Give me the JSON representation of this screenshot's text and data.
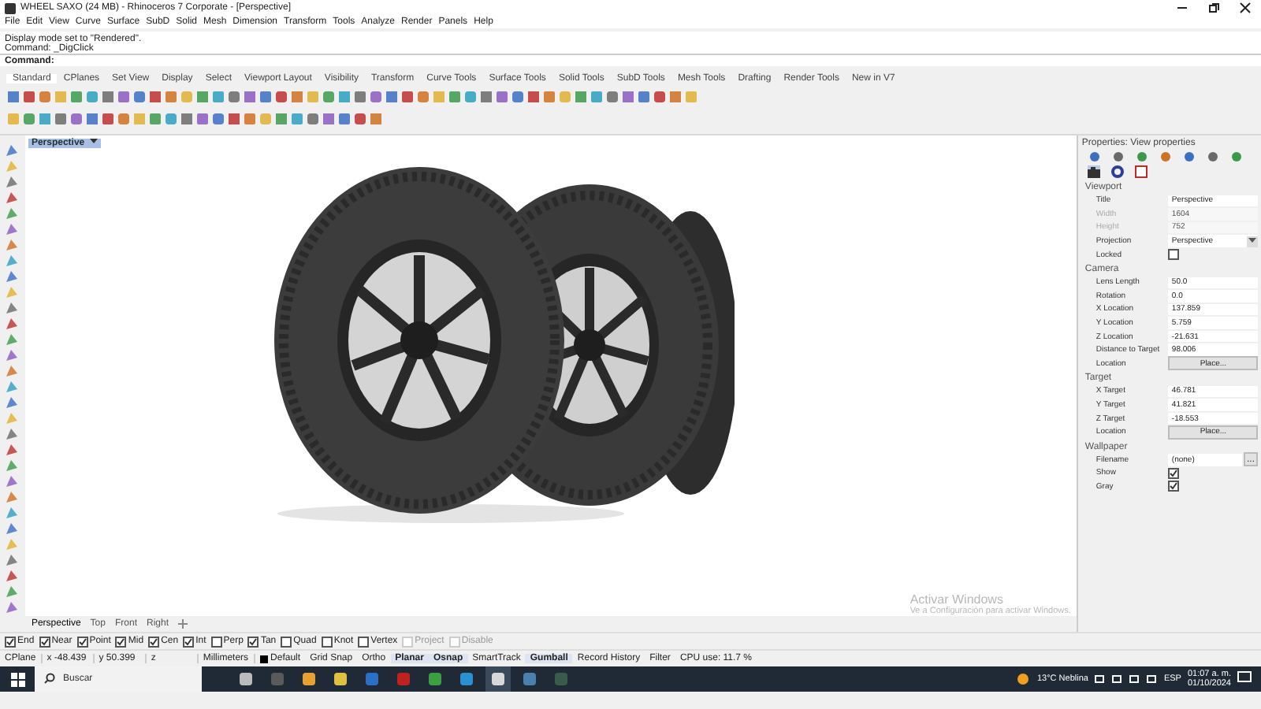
{
  "window": {
    "title": "WHEEL SAXO (24 MB) - Rhinoceros 7 Corporate - [Perspective]"
  },
  "menu": [
    "File",
    "Edit",
    "View",
    "Curve",
    "Surface",
    "SubD",
    "Solid",
    "Mesh",
    "Dimension",
    "Transform",
    "Tools",
    "Analyze",
    "Render",
    "Panels",
    "Help"
  ],
  "command_history": [
    "Display mode set to \"Rendered\".",
    "Command: _DigClick"
  ],
  "command_prompt": "Command:",
  "toolbar_tabs": [
    {
      "label": "Standard",
      "selected": true
    },
    {
      "label": "CPlanes",
      "selected": false
    },
    {
      "label": "Set View",
      "selected": false
    },
    {
      "label": "Display",
      "selected": false
    },
    {
      "label": "Select",
      "selected": false
    },
    {
      "label": "Viewport Layout",
      "selected": false
    },
    {
      "label": "Visibility",
      "selected": false
    },
    {
      "label": "Transform",
      "selected": false
    },
    {
      "label": "Curve Tools",
      "selected": false
    },
    {
      "label": "Surface Tools",
      "selected": false
    },
    {
      "label": "Solid Tools",
      "selected": false
    },
    {
      "label": "SubD Tools",
      "selected": false
    },
    {
      "label": "Mesh Tools",
      "selected": false
    },
    {
      "label": "Drafting",
      "selected": false
    },
    {
      "label": "Render Tools",
      "selected": false
    },
    {
      "label": "New in V7",
      "selected": false
    }
  ],
  "viewport": {
    "label": "Perspective"
  },
  "viewport_tabs": [
    {
      "label": "Perspective",
      "selected": true
    },
    {
      "label": "Top",
      "selected": false
    },
    {
      "label": "Front",
      "selected": false
    },
    {
      "label": "Right",
      "selected": false
    }
  ],
  "properties": {
    "title": "Properties: View properties",
    "sections": [
      {
        "heading": "Viewport",
        "rows": [
          {
            "kind": "text",
            "label": "Title",
            "value": "Perspective",
            "disabled": false
          },
          {
            "kind": "text",
            "label": "Width",
            "value": "1604",
            "disabled": true
          },
          {
            "kind": "text",
            "label": "Height",
            "value": "752",
            "disabled": true
          },
          {
            "kind": "dropdown",
            "label": "Projection",
            "value": "Perspective",
            "disabled": false
          },
          {
            "kind": "checkbox",
            "label": "Locked",
            "checked": false
          }
        ]
      },
      {
        "heading": "Camera",
        "rows": [
          {
            "kind": "text",
            "label": "Lens Length",
            "value": "50.0",
            "disabled": false
          },
          {
            "kind": "text",
            "label": "Rotation",
            "value": "0.0",
            "disabled": false
          },
          {
            "kind": "text",
            "label": "X Location",
            "value": "137.859",
            "disabled": false
          },
          {
            "kind": "text",
            "label": "Y Location",
            "value": "5.759",
            "disabled": false
          },
          {
            "kind": "text",
            "label": "Z Location",
            "value": "-21.631",
            "disabled": false
          },
          {
            "kind": "text",
            "label": "Distance to Target",
            "value": "98.006",
            "disabled": false
          },
          {
            "kind": "button",
            "label": "Location",
            "value": "Place..."
          }
        ]
      },
      {
        "heading": "Target",
        "rows": [
          {
            "kind": "text",
            "label": "X Target",
            "value": "46.781",
            "disabled": false
          },
          {
            "kind": "text",
            "label": "Y Target",
            "value": "41.821",
            "disabled": false
          },
          {
            "kind": "text",
            "label": "Z Target",
            "value": "-18.553",
            "disabled": false
          },
          {
            "kind": "button",
            "label": "Location",
            "value": "Place..."
          }
        ]
      },
      {
        "heading": "Wallpaper",
        "rows": [
          {
            "kind": "file",
            "label": "Filename",
            "value": "(none)",
            "button": "..."
          },
          {
            "kind": "checkbox",
            "label": "Show",
            "checked": true
          },
          {
            "kind": "checkbox",
            "label": "Gray",
            "checked": true
          }
        ]
      }
    ]
  },
  "osnaps": [
    {
      "label": "End",
      "checked": true,
      "disabled": false
    },
    {
      "label": "Near",
      "checked": true,
      "disabled": false
    },
    {
      "label": "Point",
      "checked": true,
      "disabled": false
    },
    {
      "label": "Mid",
      "checked": true,
      "disabled": false
    },
    {
      "label": "Cen",
      "checked": true,
      "disabled": false
    },
    {
      "label": "Int",
      "checked": true,
      "disabled": false
    },
    {
      "label": "Perp",
      "checked": false,
      "disabled": false
    },
    {
      "label": "Tan",
      "checked": true,
      "disabled": false
    },
    {
      "label": "Quad",
      "checked": false,
      "disabled": false
    },
    {
      "label": "Knot",
      "checked": false,
      "disabled": false
    },
    {
      "label": "Vertex",
      "checked": false,
      "disabled": false
    },
    {
      "label": "Project",
      "checked": false,
      "disabled": true
    },
    {
      "label": "Disable",
      "checked": false,
      "disabled": true
    }
  ],
  "status_bar": {
    "cplane": "CPlane",
    "x": "x -48.439",
    "y": "y 50.399",
    "z": "z",
    "units": "Millimeters",
    "layer": "Default",
    "toggles": [
      {
        "label": "Grid Snap",
        "on": false
      },
      {
        "label": "Ortho",
        "on": false
      },
      {
        "label": "Planar",
        "on": true
      },
      {
        "label": "Osnap",
        "on": true
      },
      {
        "label": "SmartTrack",
        "on": false
      },
      {
        "label": "Gumball",
        "on": true
      },
      {
        "label": "Record History",
        "on": false
      },
      {
        "label": "Filter",
        "on": false
      }
    ],
    "cpu": "CPU use: 11.7 %"
  },
  "activation_notice": {
    "title": "Activar Windows",
    "subtitle": "Ve a Configuración para activar Windows."
  },
  "taskbar": {
    "search": "Buscar",
    "weather": "13°C  Neblina",
    "language": "ESP",
    "time": "01:07 a. m.",
    "date": "01/10/2024"
  }
}
